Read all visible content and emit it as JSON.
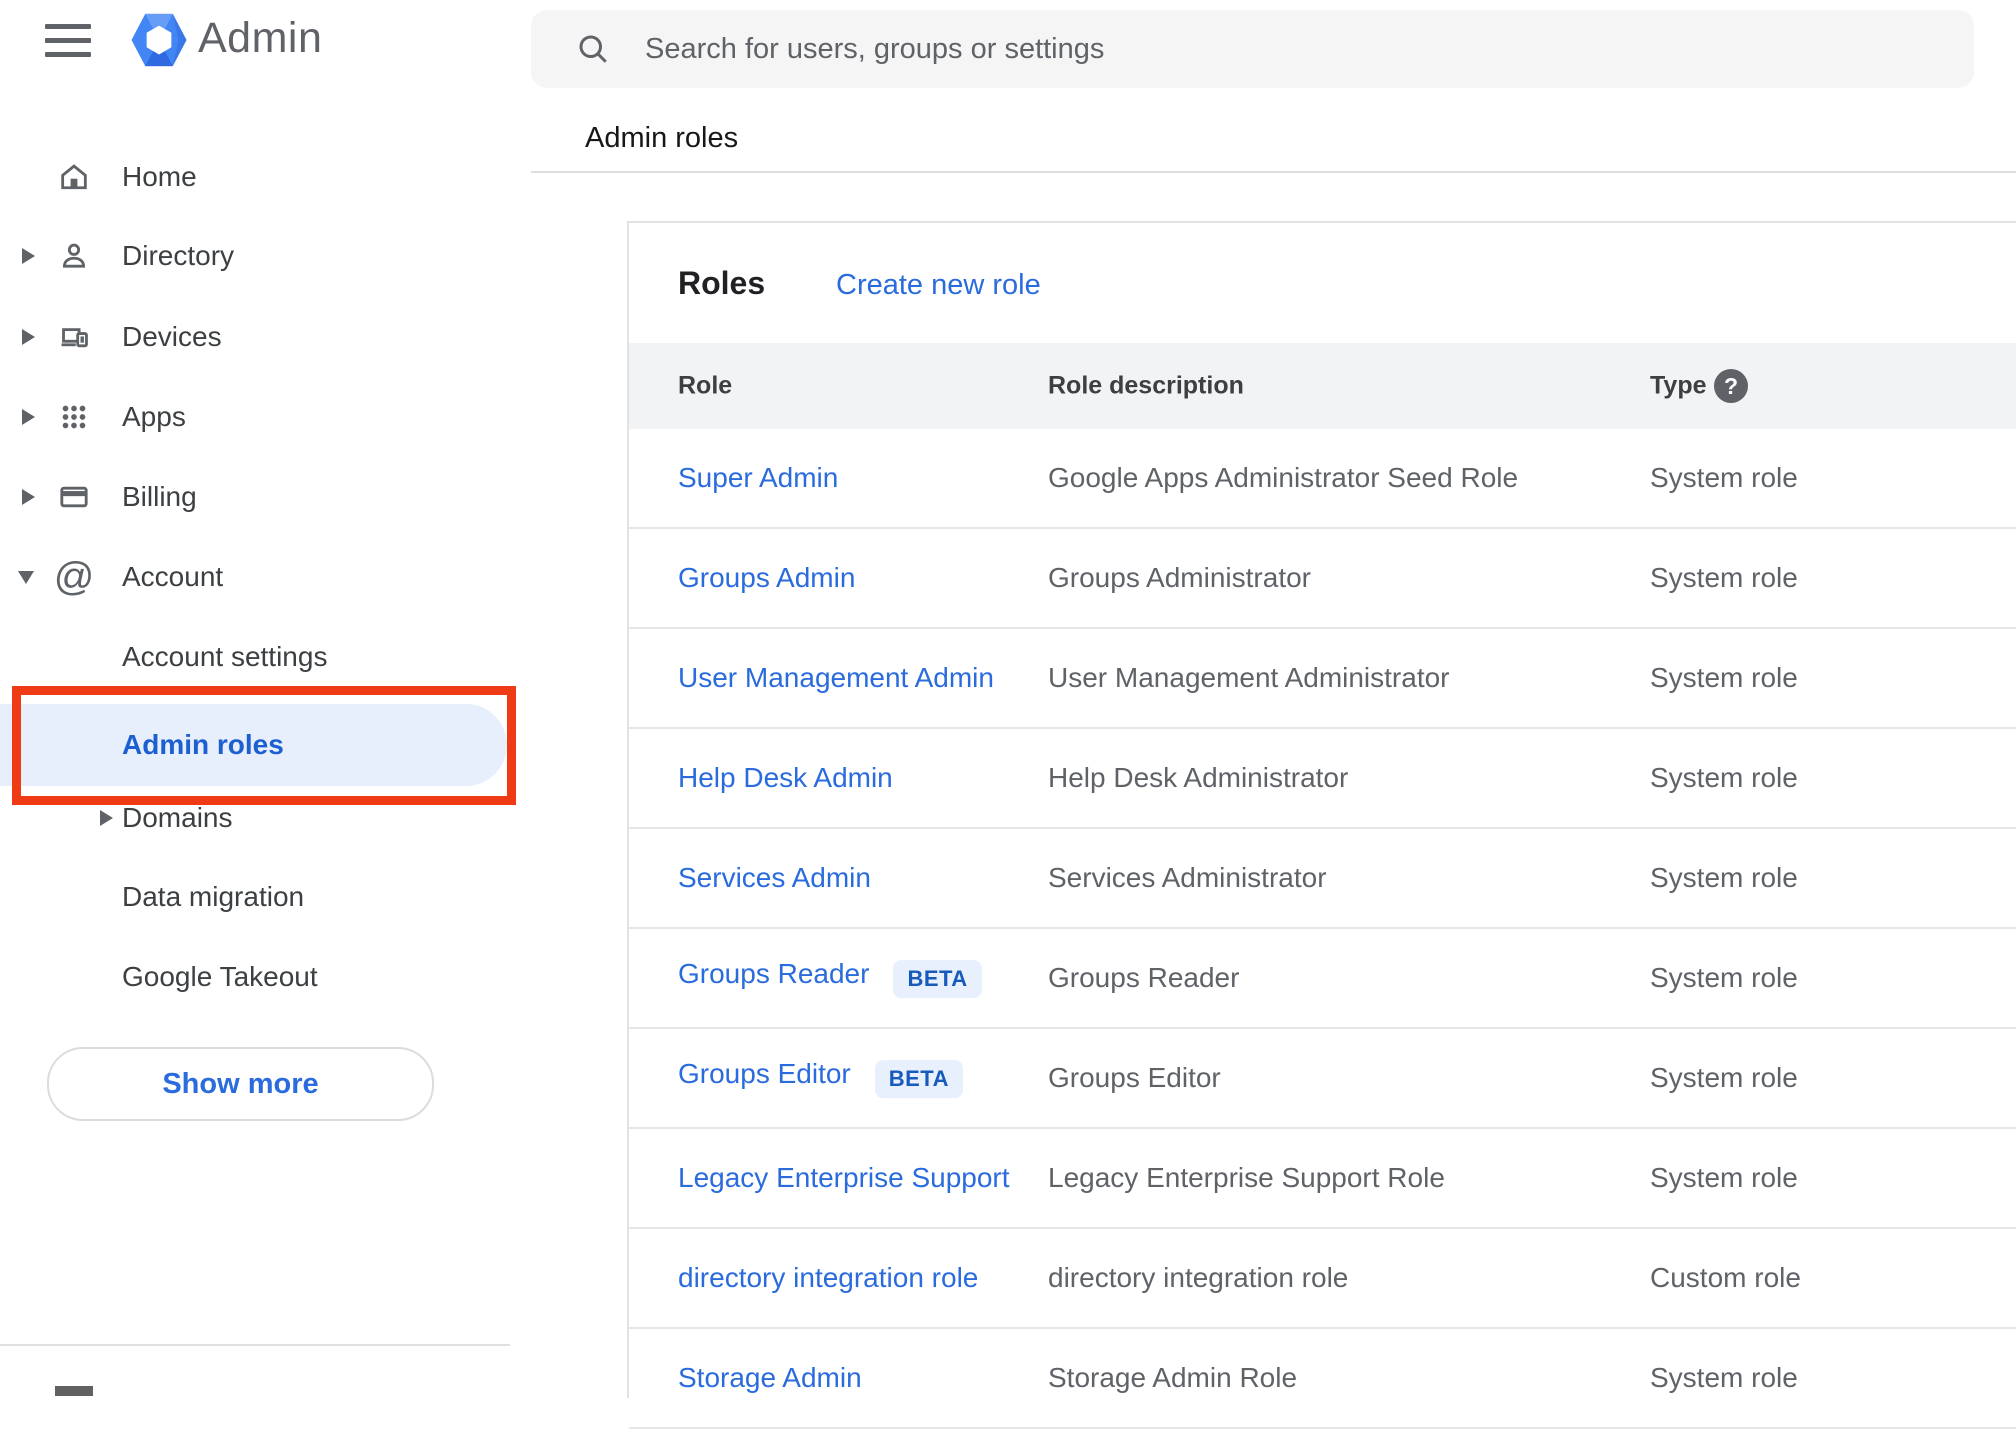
{
  "app": {
    "logo_text": "Admin"
  },
  "search": {
    "placeholder": "Search for users, groups or settings"
  },
  "breadcrumb": {
    "label": "Admin roles"
  },
  "sidebar": {
    "items": [
      {
        "label": "Home",
        "icon": "home-icon",
        "expandable": false
      },
      {
        "label": "Directory",
        "icon": "person-icon",
        "expandable": true
      },
      {
        "label": "Devices",
        "icon": "devices-icon",
        "expandable": true
      },
      {
        "label": "Apps",
        "icon": "apps-grid-icon",
        "expandable": true
      },
      {
        "label": "Billing",
        "icon": "credit-card-icon",
        "expandable": true
      },
      {
        "label": "Account",
        "icon": "at-sign-icon",
        "expandable": true,
        "expanded": true
      }
    ],
    "account_children": [
      {
        "label": "Account settings"
      },
      {
        "label": "Admin roles",
        "active": true
      },
      {
        "label": "Domains",
        "expandable": true
      },
      {
        "label": "Data migration"
      },
      {
        "label": "Google Takeout"
      }
    ],
    "show_more_label": "Show more"
  },
  "icons": {
    "at_glyph": "@"
  },
  "main": {
    "panel_title": "Roles",
    "create_role_link": "Create new role",
    "table": {
      "columns": [
        "Role",
        "Role description",
        "Type"
      ],
      "help_glyph": "?",
      "rows": [
        {
          "role": "Super Admin",
          "description": "Google Apps Administrator Seed Role",
          "type": "System role"
        },
        {
          "role": "Groups Admin",
          "description": "Groups Administrator",
          "type": "System role"
        },
        {
          "role": "User Management Admin",
          "description": "User Management Administrator",
          "type": "System role"
        },
        {
          "role": "Help Desk Admin",
          "description": "Help Desk Administrator",
          "type": "System role"
        },
        {
          "role": "Services Admin",
          "description": "Services Administrator",
          "type": "System role"
        },
        {
          "role": "Groups Reader",
          "beta_label": "BETA",
          "description": "Groups Reader",
          "type": "System role"
        },
        {
          "role": "Groups Editor",
          "beta_label": "BETA",
          "description": "Groups Editor",
          "type": "System role"
        },
        {
          "role": "Legacy Enterprise Support",
          "description": "Legacy Enterprise Support Role",
          "type": "System role"
        },
        {
          "role": "directory integration role",
          "description": "directory integration role",
          "type": "Custom role"
        },
        {
          "role": "Storage Admin",
          "description": "Storage Admin Role",
          "type": "System role"
        }
      ]
    }
  },
  "annotation": {
    "shape": "rectangle",
    "around": "Admin roles sidebar item",
    "color": "#ee3b16"
  },
  "colors": {
    "accent_blue": "#2a6bdd",
    "active_item_blue": "#1b5fd1",
    "active_item_bg": "#e7eefc",
    "beta_bg": "#e8f0fe",
    "beta_text": "#185abc",
    "header_band_bg": "#f1f3f4",
    "divider": "#e0e0e0",
    "annotation_red": "#ee3b16",
    "search_bg": "#f5f5f5",
    "text_primary": "#202124",
    "text_secondary": "#5f6368"
  }
}
